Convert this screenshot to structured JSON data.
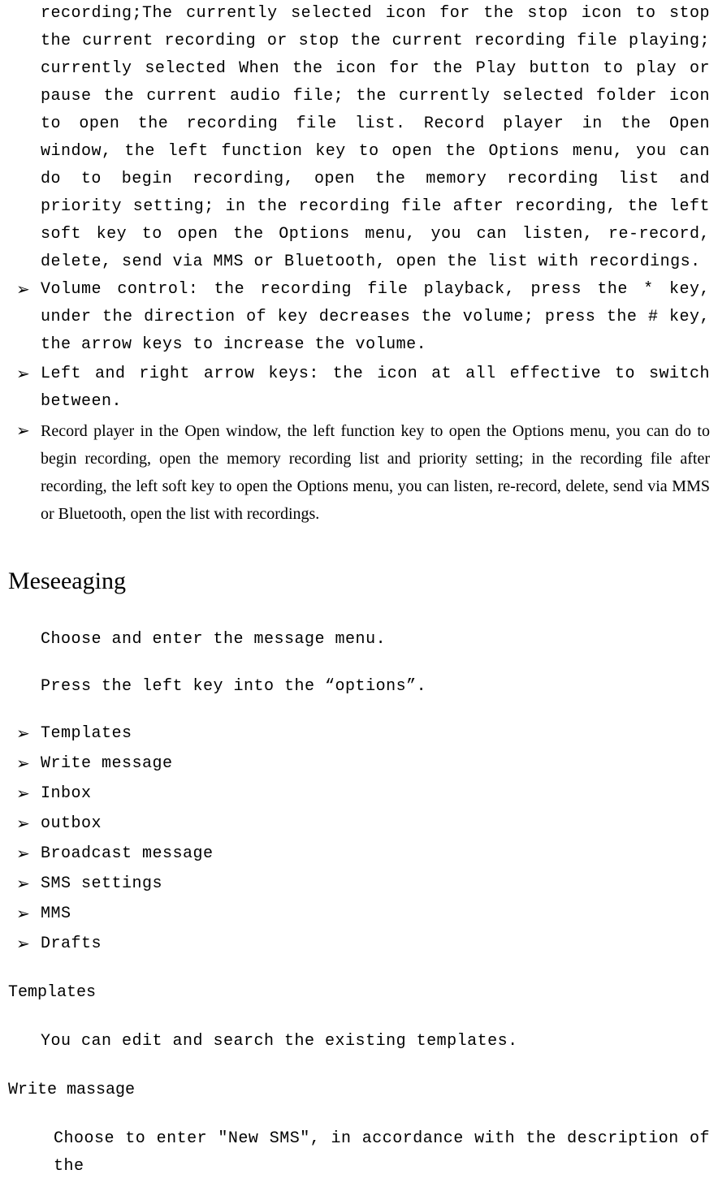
{
  "top_paragraph": "recording;The currently selected icon for the stop icon to stop the current recording or stop the current recording file playing; currently selected When the icon for the Play button to play or pause the current audio file; the currently selected folder icon to open the recording file list. Record player in the Open window, the left function key to open the Options menu, you can do to begin recording, open the memory recording list and priority setting; in the recording file after recording, the left soft key to open the Options menu, you can listen, re-record, delete, send via MMS or Bluetooth, open the list with recordings.",
  "bullets": [
    "Volume control: the recording file playback, press the * key, under the direction of key decreases the volume; press the # key, the arrow keys to increase the volume.",
    "Left and right arrow keys: the icon at all effective to switch between.",
    "Record player in the Open window, the left function key to open the Options menu, you can do to begin recording, open the memory recording list and priority setting; in the recording file after recording, the left soft key to open the Options menu, you can listen, re-record, delete, send via MMS or Bluetooth, open the list with recordings."
  ],
  "messaging": {
    "heading": "Meseeaging",
    "intro1": "Choose and enter the message menu.",
    "intro2": "Press the left key into the “options”.",
    "options": [
      "Templates",
      "Write message",
      "Inbox",
      "outbox",
      "Broadcast message",
      "SMS settings",
      "MMS",
      "Drafts"
    ]
  },
  "templates": {
    "heading": "Templates",
    "body": "You can edit and search the existing templates."
  },
  "write_message": {
    "heading": "Write massage",
    "body": "Choose to enter \"New SMS\", in accordance with the description of the"
  }
}
